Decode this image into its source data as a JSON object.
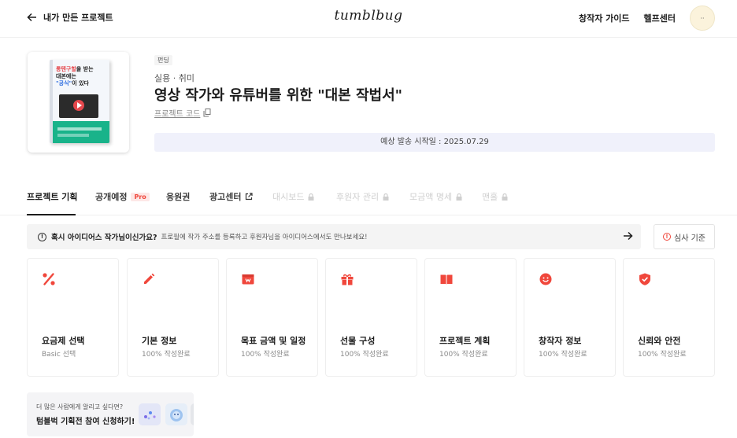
{
  "header": {
    "back_label": "내가 만든 프로젝트",
    "logo": "tumblbug",
    "links": [
      "창작자 가이드",
      "헬프센터"
    ],
    "avatar_text": "··"
  },
  "project": {
    "cover_text": {
      "line1_prefix": "롱텐구할",
      "line1_suffix": "을 받는",
      "line2": "대본에는",
      "line3_prefix": "\"공식\"",
      "line3_suffix": "이 있다"
    },
    "funding_badge": "펀딩",
    "category": "실용 · 취미",
    "title": "영상 작가와 유튜버를 위한 \"대본 작법서\"",
    "code_label": "프로젝트 코드",
    "shipping": "예상 발송 시작일 : 2025.07.29"
  },
  "tabs": [
    {
      "label": "프로젝트 기획",
      "state": "active"
    },
    {
      "label": "공개예정",
      "badge": "Pro",
      "state": "normal"
    },
    {
      "label": "응원권",
      "state": "normal"
    },
    {
      "label": "광고센터",
      "icon": "external-link-icon",
      "state": "normal"
    },
    {
      "label": "대시보드",
      "icon": "lock-icon",
      "state": "locked"
    },
    {
      "label": "후원자 관리",
      "icon": "lock-icon",
      "state": "locked"
    },
    {
      "label": "모금액 명세",
      "icon": "lock-icon",
      "state": "locked"
    },
    {
      "label": "맨홀",
      "icon": "lock-icon",
      "state": "locked"
    }
  ],
  "notice": {
    "bold": "혹시 아이디어스 작가님이신가요?",
    "text": "프로필에 작가 주소를 등록하고 후원자님을 아이디어스에서도 만나보세요!"
  },
  "review_label": "심사 기준",
  "cards": [
    {
      "title": "요금제 선택",
      "status": "Basic 선택",
      "icon": "percent-icon"
    },
    {
      "title": "기본 정보",
      "status": "100% 작성완료",
      "icon": "pencil-icon"
    },
    {
      "title": "목표 금액 및 일정",
      "status": "100% 작성완료",
      "icon": "wallet-icon"
    },
    {
      "title": "선물 구성",
      "status": "100% 작성완료",
      "icon": "gift-icon"
    },
    {
      "title": "프로젝트 계획",
      "status": "100% 작성완료",
      "icon": "book-icon"
    },
    {
      "title": "창작자 정보",
      "status": "100% 작성완료",
      "icon": "smile-icon"
    },
    {
      "title": "신뢰와 안전",
      "status": "100% 작성완료",
      "icon": "shield-icon"
    }
  ],
  "banner": {
    "sub": "더 많은 사람에게 알리고 싶다면?",
    "main": "텀블벅 기획전 참여 신청하기!"
  },
  "colors": {
    "accent": "#f0473c",
    "ship_bg": "#f0f1fb"
  }
}
